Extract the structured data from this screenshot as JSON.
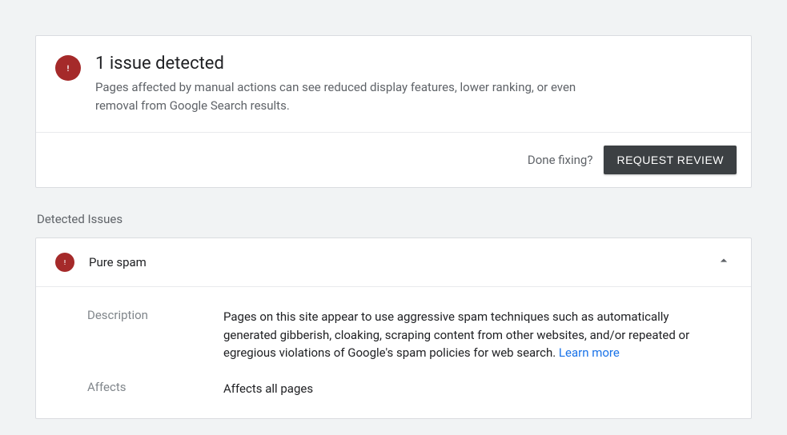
{
  "summary": {
    "title": "1 issue detected",
    "subtitle": "Pages affected by manual actions can see reduced display features, lower ranking, or even removal from Google Search results.",
    "done_fixing_label": "Done fixing?",
    "request_review_label": "REQUEST REVIEW"
  },
  "section_title": "Detected Issues",
  "issue": {
    "title": "Pure spam",
    "description_label": "Description",
    "description_text": "Pages on this site appear to use aggressive spam techniques such as automatically generated gibberish, cloaking, scraping content from other websites, and/or repeated or egregious violations of Google's spam policies for web search. ",
    "learn_more_label": "Learn more",
    "affects_label": "Affects",
    "affects_text": "Affects all pages"
  }
}
